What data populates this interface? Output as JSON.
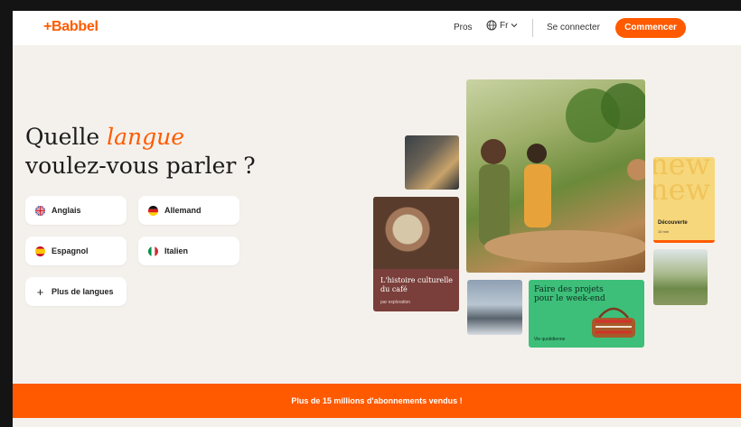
{
  "header": {
    "logo": "+Babbel",
    "pros": "Pros",
    "language": "Fr",
    "login": "Se connecter",
    "start": "Commencer"
  },
  "hero": {
    "title_before": "Quelle ",
    "title_accent": "langue",
    "title_after": "voulez-vous parler ?"
  },
  "languages": [
    {
      "label": "Anglais",
      "flag": "uk-flag"
    },
    {
      "label": "Allemand",
      "flag": "germany-flag"
    },
    {
      "label": "Espagnol",
      "flag": "spain-flag"
    },
    {
      "label": "Italien",
      "flag": "italy-flag"
    },
    {
      "label": "Plus de langues",
      "flag": "plus-icon"
    }
  ],
  "cards": {
    "cafe_title": "L'histoire culturelle du café",
    "cafe_sub": "par exploration",
    "weekend_title": "Faire des projets pour le week-end",
    "weekend_sub": "Vie quotidienne",
    "new_word": "new",
    "new_label": "Découverte",
    "new_sub": "10 min"
  },
  "banner": "Plus de 15 millions d'abonnements vendus !",
  "colors": {
    "brand": "#ff5a00",
    "background": "#f4f1ec",
    "weekend_card": "#3dbf7a",
    "cafe_card": "#7a3f3a",
    "new_card": "#f7d77b"
  }
}
